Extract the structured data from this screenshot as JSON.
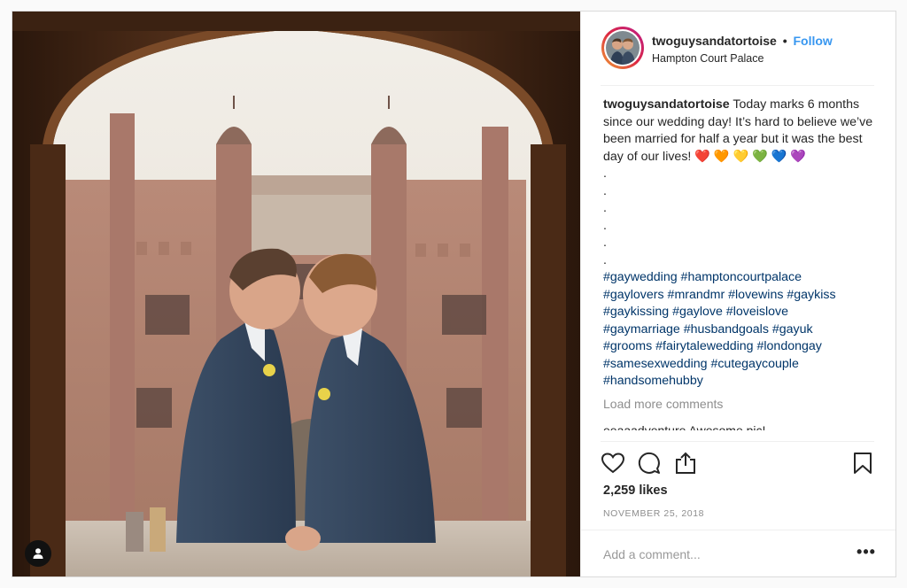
{
  "post": {
    "username": "twoguysandatortoise",
    "follow_label": "Follow",
    "location": "Hampton Court Palace",
    "caption_user": "twoguysandatortoise",
    "caption_text": "Today marks 6 months since our wedding day! It’s hard to believe we’ve been married for half a year but it was the best day of our lives! ❤️ 🧡 💛 💚 💙 💜",
    "dots": [
      ".",
      ".",
      ".",
      ".",
      ".",
      "."
    ],
    "hashtag_lines": [
      "#gaywedding #hamptoncourtpalace",
      "#gaylovers #mrandmr #lovewins #gaykiss",
      "#gaykissing #gaylove #loveislove",
      "#gaymarriage #husbandgoals #gayuk",
      "#grooms #fairytalewedding #londongay",
      "#samesexwedding #cutegaycouple",
      "#handsomehubby"
    ],
    "load_more": "Load more comments",
    "partial_comment": "eeaaadventure Awesome pic!",
    "likes": "2,259 likes",
    "date": "NOVEMBER 25, 2018",
    "comment_placeholder": "Add a comment...",
    "more_label": "•••"
  },
  "icons": {
    "like": "heart-icon",
    "comment": "comment-icon",
    "share": "share-icon",
    "save": "bookmark-icon",
    "user_tag": "user-tag-icon"
  },
  "colors": {
    "link": "#003569",
    "follow": "#3897f0",
    "muted": "#8e8e8e"
  }
}
